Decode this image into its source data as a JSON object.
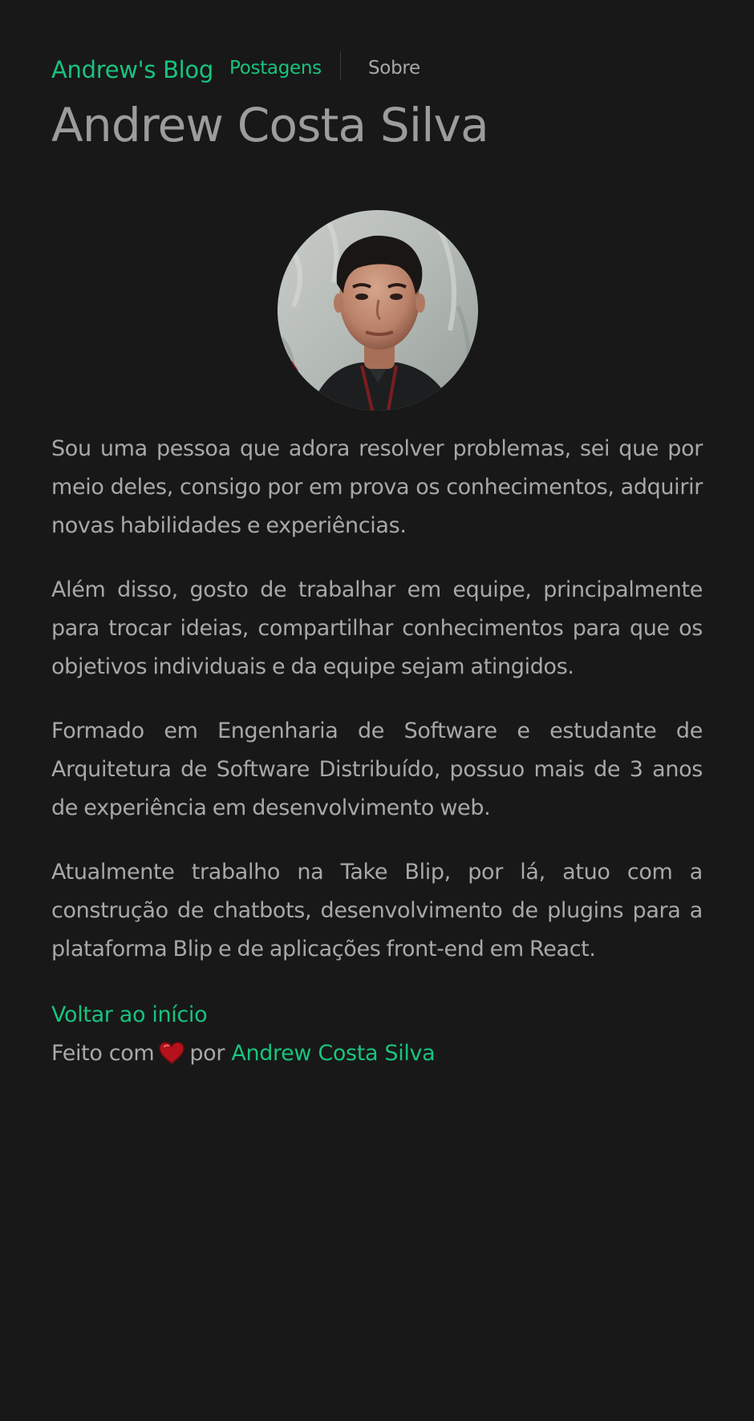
{
  "nav": {
    "brand": "Andrew's Blog",
    "links": [
      {
        "label": "Postagens",
        "active": true
      },
      {
        "label": "Sobre",
        "active": false
      }
    ]
  },
  "page": {
    "title": "Andrew Costa Silva",
    "avatar_alt": "profile-photo"
  },
  "content": {
    "paragraphs": [
      "Sou uma pessoa que adora resolver problemas, sei que por meio deles, consigo por em prova os conhecimentos, adquirir novas habilidades e experiências.",
      "Além disso, gosto de trabalhar em equipe, principalmente para trocar ideias, compartilhar conhecimentos para que os objetivos individuais e da equipe sejam atingidos.",
      "Formado em Engenharia de Software e estudante de Arquitetura de Software Distribuído, possuo mais de 3 anos de experiência em desenvolvimento web.",
      "Atualmente trabalho na Take Blip, por lá, atuo com a construção de chatbots, desenvolvimento de plugins para a plataforma Blip e de aplicações front-end em React."
    ]
  },
  "footer": {
    "back_label": "Voltar ao início",
    "made_with": "Feito com",
    "by": "por",
    "author": "Andrew Costa Silva",
    "heart_icon": "heart-icon"
  },
  "colors": {
    "background": "#181818",
    "accent": "#19c37d",
    "text": "#a8a8a8",
    "heading": "#9c9c9c",
    "heart": "#b5121b"
  }
}
